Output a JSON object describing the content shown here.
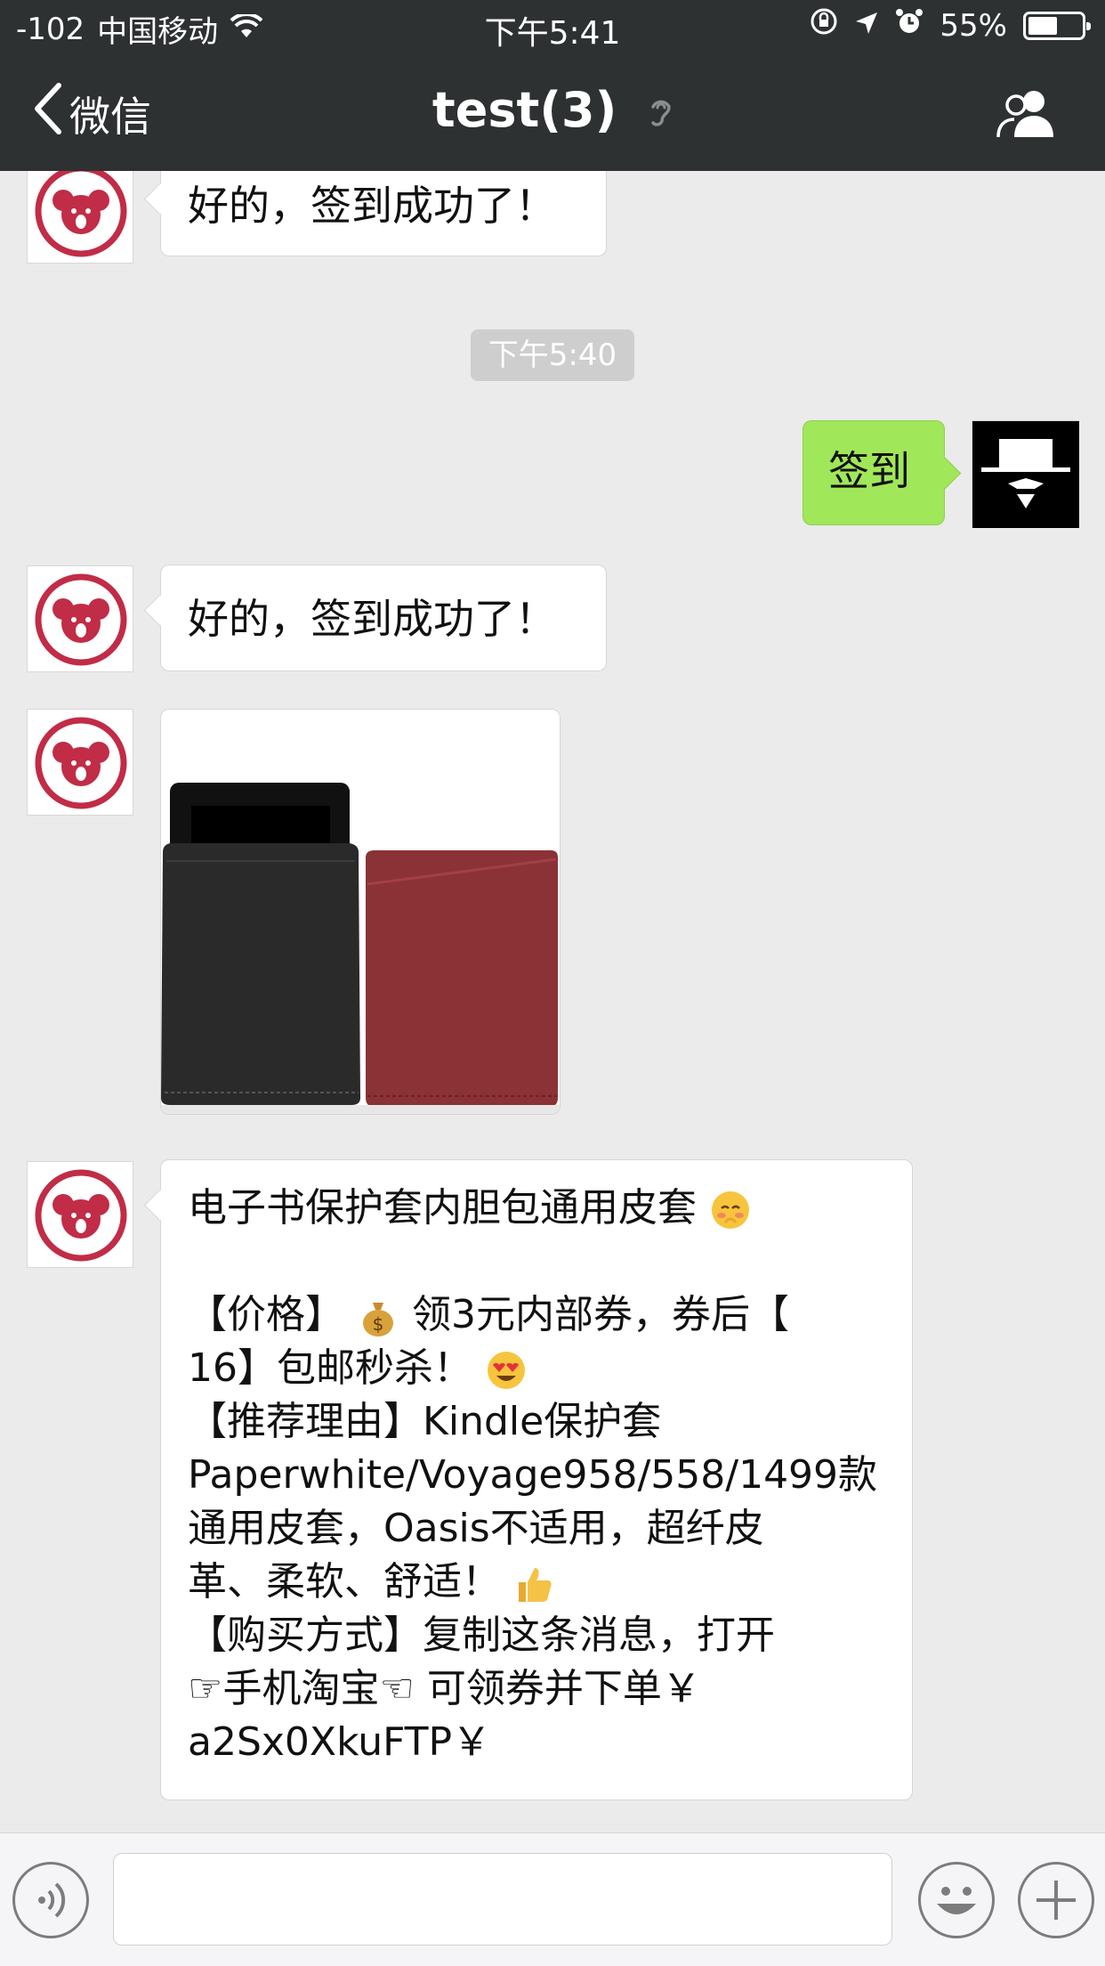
{
  "status": {
    "signal": "-102",
    "carrier": "中国移动",
    "time": "下午5:41",
    "battery_text": "55%",
    "battery_level": 0.55
  },
  "nav": {
    "back_label": "微信",
    "title": "test(3)"
  },
  "chat": {
    "timestamp": "下午5:40",
    "messages": [
      {
        "side": "left",
        "type": "text",
        "text": "好的，签到成功了！"
      },
      {
        "side": "right",
        "type": "text",
        "text": "签到"
      },
      {
        "side": "left",
        "type": "text",
        "text": "好的，签到成功了！"
      },
      {
        "side": "left",
        "type": "image",
        "alt": "tablet-sleeves"
      },
      {
        "side": "left",
        "type": "text",
        "lines": [
          "电子书保护套内胆包通用皮套",
          "",
          "【价格】",
          "领3元内部券，券后【",
          "16】包邮秒杀！",
          "【推荐理由】Kindle保护套",
          "Paperwhite/Voyage958/558/1499款",
          "通用皮套，Oasis不适用，超纤皮",
          "革、柔软、舒适！",
          "【购买方式】复制这条消息，打开",
          "☞手机淘宝☜ 可领券并下单￥",
          "a2Sx0XkuFTP￥"
        ]
      }
    ]
  },
  "input": {
    "value": ""
  },
  "colors": {
    "nav_bg": "#2e3132",
    "chat_bg": "#ebebeb",
    "bubble_self": "#a0e75a",
    "avatar_koala": "#c12c47"
  }
}
